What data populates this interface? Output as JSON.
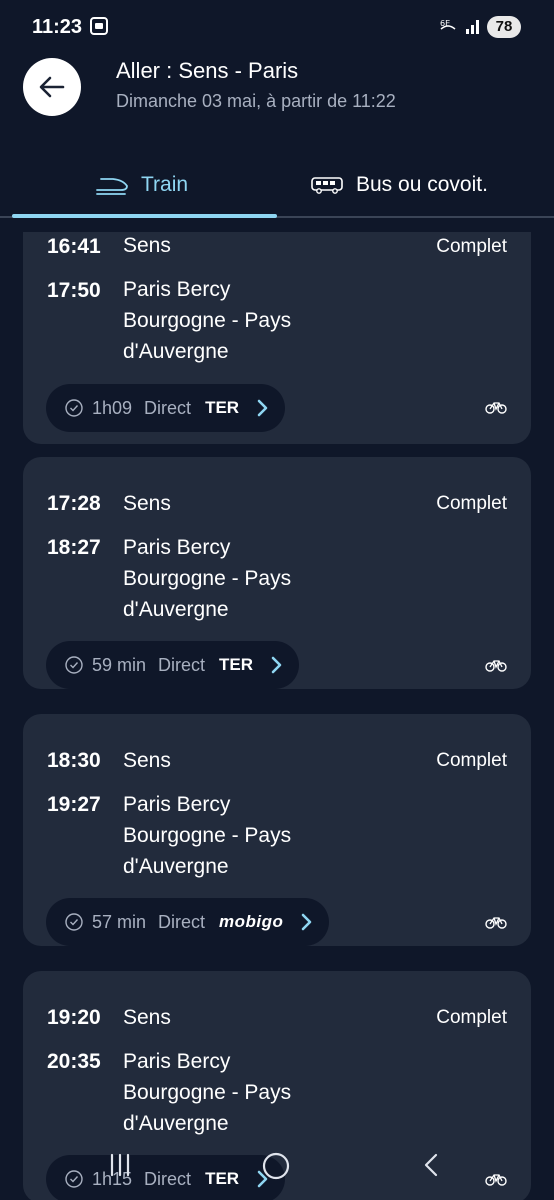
{
  "status_bar": {
    "time": "11:23",
    "battery": "78"
  },
  "header": {
    "title": "Aller : Sens - Paris",
    "subtitle": "Dimanche 03 mai, à partir de 11:22"
  },
  "tabs": [
    {
      "label": "Train",
      "icon": "train-icon",
      "selected": true
    },
    {
      "label": "Bus ou covoit.",
      "icon": "bus-icon",
      "selected": false
    }
  ],
  "journeys": [
    {
      "dep_time": "16:41",
      "dep_station": "Sens",
      "arr_time": "17:50",
      "arr_station_lines": [
        "Paris Bercy",
        "Bourgogne - Pays",
        "d'Auvergne"
      ],
      "status": "Complet",
      "duration": "1h09",
      "type": "Direct",
      "brand": "TER"
    },
    {
      "dep_time": "17:28",
      "dep_station": "Sens",
      "arr_time": "18:27",
      "arr_station_lines": [
        "Paris Bercy",
        "Bourgogne - Pays",
        "d'Auvergne"
      ],
      "status": "Complet",
      "duration": "59 min",
      "type": "Direct",
      "brand": "TER"
    },
    {
      "dep_time": "18:30",
      "dep_station": "Sens",
      "arr_time": "19:27",
      "arr_station_lines": [
        "Paris Bercy",
        "Bourgogne - Pays",
        "d'Auvergne"
      ],
      "status": "Complet",
      "duration": "57 min",
      "type": "Direct",
      "brand": "mobigo"
    },
    {
      "dep_time": "19:20",
      "dep_station": "Sens",
      "arr_time": "20:35",
      "arr_station_lines": [
        "Paris Bercy",
        "Bourgogne - Pays",
        "d'Auvergne"
      ],
      "status": "Complet",
      "duration": "1h15",
      "type": "Direct",
      "brand": "TER"
    }
  ],
  "colors": {
    "background": "#0f1729",
    "card": "#222b3c",
    "accent": "#8fd6f2",
    "muted": "#a8b0c0"
  }
}
